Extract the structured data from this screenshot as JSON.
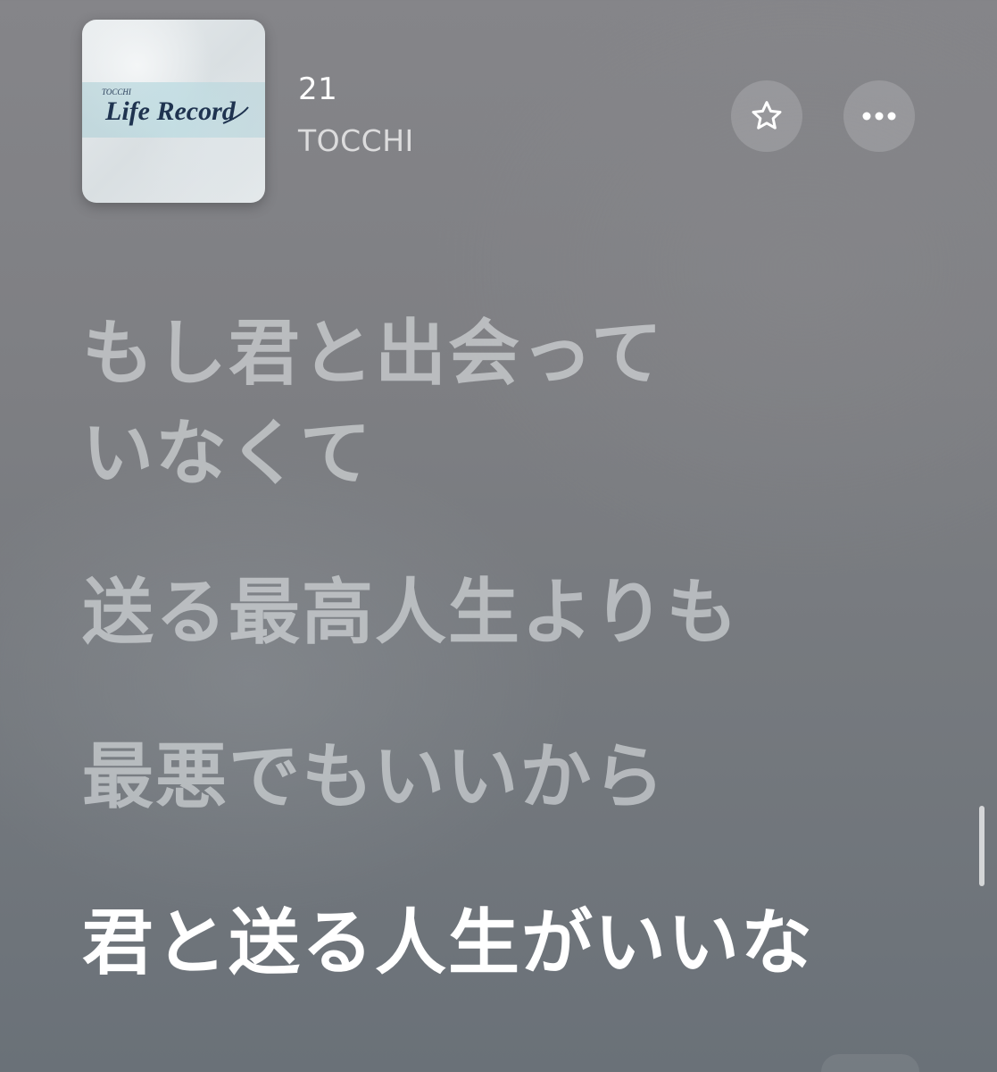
{
  "now_playing": {
    "artwork": {
      "logo_text": "Life Record",
      "small_text": "TOCCHI"
    },
    "title": "21",
    "artist": "TOCCHI",
    "icons": {
      "favorite": "star-icon",
      "more": "ellipsis-icon"
    }
  },
  "lyrics": {
    "lines": [
      {
        "text": "もし君と出会って\nいなくて",
        "active": false
      },
      {
        "text": "送る最高人生よりも",
        "active": false
      },
      {
        "text": "最悪でもいいから",
        "active": false
      },
      {
        "text": "君と送る人生がいいな",
        "active": true
      }
    ]
  },
  "colors": {
    "background": "#7e7f83",
    "active_lyric": "#ffffff",
    "inactive_lyric": "#c9ccd0"
  }
}
